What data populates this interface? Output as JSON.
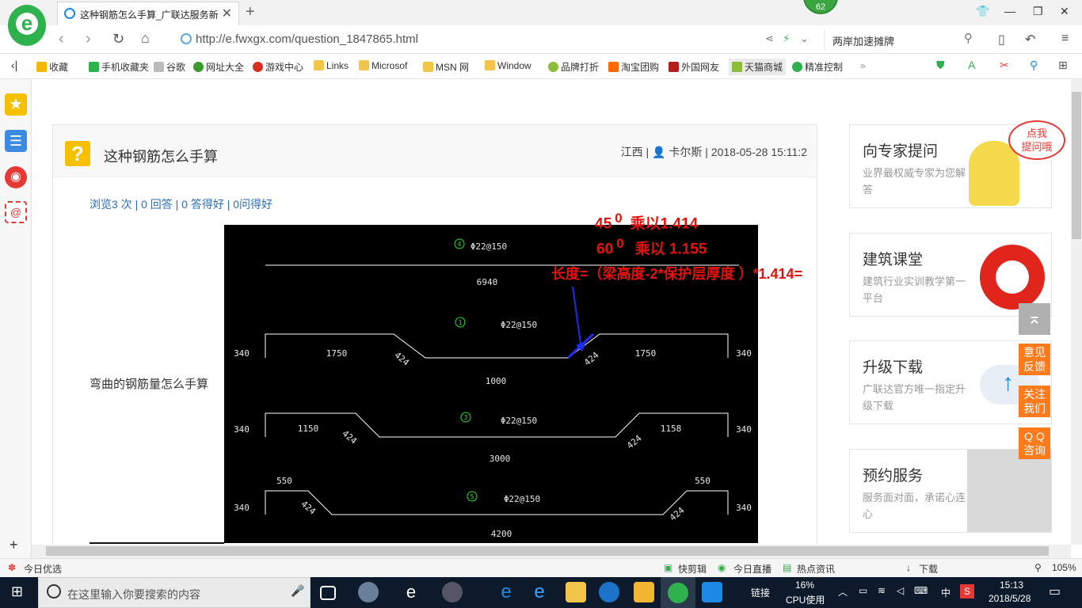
{
  "browser": {
    "tab_title": "这种钢筋怎么手算_广联达服务新",
    "tab_close": "✕",
    "new_tab": "+",
    "badge_count": "62",
    "url": "http://e.fwxgx.com/question_1847865.html",
    "search_value": "两岸加速摊牌",
    "window_controls": {
      "shirt": "👕",
      "minimize": "—",
      "restore": "❐",
      "close": "✕"
    }
  },
  "bookmarks": [
    {
      "label": "收藏",
      "color": "#f5b800"
    },
    {
      "label": "手机收藏夹",
      "color": "#2fb14d"
    },
    {
      "label": "谷歌",
      "color": "#bbbbbb"
    },
    {
      "label": "网址大全",
      "color": "#3a9a2e"
    },
    {
      "label": "游戏中心",
      "color": "#d9301f"
    },
    {
      "label": "Links",
      "color": "#f2c44a"
    },
    {
      "label": "Microsof",
      "color": "#f2c44a"
    },
    {
      "label": "MSN 网",
      "color": "#f2c44a"
    },
    {
      "label": "Window",
      "color": "#f2c44a"
    },
    {
      "label": "品牌打折",
      "color": "#8dbb3a"
    },
    {
      "label": "淘宝团购",
      "color": "#ff6a00"
    },
    {
      "label": "外国网友",
      "color": "#b71c1c"
    },
    {
      "label": "天猫商城",
      "color": "#8dbb3a"
    },
    {
      "label": "精准控制",
      "color": "#2fb14d"
    }
  ],
  "question": {
    "title": "这种钢筋怎么手算",
    "icon": "?",
    "meta": "江西 | 👤 卡尔斯 | 2018-05-28 15:11:2",
    "stats": "浏览3 次 | 0 回答 | 0 答得好 | 0问得好",
    "body": "弯曲的钢筋量怎么手算"
  },
  "annotations": {
    "line1": "45",
    "line1_sup": "0",
    "line1_rest": "乘以1.414",
    "line2": "60",
    "line2_sup": "0",
    "line2_rest": "乘以  1.155",
    "line3": "长度=（梁高度-2*保护层厚度 ）*1.414="
  },
  "drawing": {
    "labels": {
      "n1": "4",
      "n1_spec": "Φ22@150",
      "n1_len": "6940",
      "n2": "1",
      "n2_spec": "Φ22@150",
      "n2_a": "1750",
      "n2_b": "1750",
      "n2_mid": "1000",
      "n2_left": "340",
      "n2_right": "340",
      "n2_d1": "424",
      "n2_d2": "424",
      "n3": "3",
      "n3_spec": "Φ22@150",
      "n3_a": "1150",
      "n3_b": "1158",
      "n3_mid": "3000",
      "n3_left": "340",
      "n3_right": "340",
      "n3_d1": "424",
      "n3_d2": "424",
      "n4": "5",
      "n4_spec": "Φ22@150",
      "n4_a": "550",
      "n4_b": "550",
      "n4_mid": "4200",
      "n4_left": "340",
      "n4_right": "340",
      "n4_d1": "424",
      "n4_d2": "424"
    }
  },
  "right_cards": [
    {
      "title": "向专家提问",
      "desc": "业界最权威专家为您解答",
      "bubble": "点我\n提问哦"
    },
    {
      "title": "建筑课堂",
      "desc": "建筑行业实训教学第一平台"
    },
    {
      "title": "升级下载",
      "desc": "广联达官方唯一指定升级下载"
    },
    {
      "title": "预约服务",
      "desc": "服务面对面，承诺心连心"
    }
  ],
  "float_buttons": [
    {
      "label": "意见\n反馈"
    },
    {
      "label": "关注\n我们"
    },
    {
      "label": "Q Q\n咨询"
    }
  ],
  "statusbar": {
    "left": "今日优选",
    "items": [
      "快剪辑",
      "今日直播",
      "热点资讯",
      "下载"
    ],
    "zoom": "105%"
  },
  "taskbar": {
    "search_placeholder": "在这里输入你要搜索的内容",
    "links": "链接",
    "cpu_percent": "16%",
    "cpu_label": "CPU使用",
    "ime": "中",
    "time": "15:13",
    "date": "2018/5/28"
  },
  "colors": {
    "accent_green": "#2fb14d",
    "annotation_red": "#e0140f",
    "link_blue": "#2a6eb8",
    "float_orange": "#ff7a1a"
  }
}
